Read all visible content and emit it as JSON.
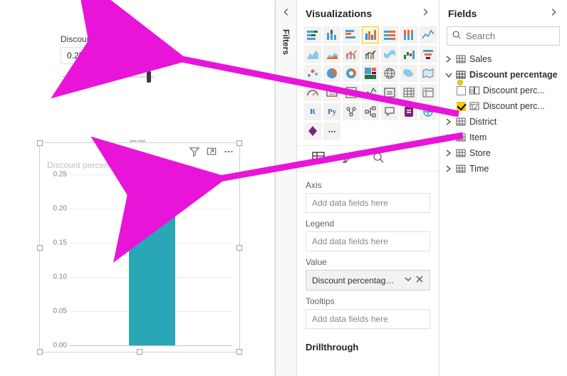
{
  "canvas": {
    "param_label": "Discount percentage",
    "param_value": "0.25",
    "visual_title": "Discount percentage Value"
  },
  "chart_data": {
    "type": "bar",
    "categories": [
      ""
    ],
    "values": [
      0.25
    ],
    "title": "Discount percentage Value",
    "xlabel": "",
    "ylabel": "",
    "ylim": [
      0.0,
      0.25
    ],
    "yticks": [
      0.0,
      0.05,
      0.1,
      0.15,
      0.2,
      0.25
    ]
  },
  "filters": {
    "label": "Filters"
  },
  "vis": {
    "title": "Visualizations",
    "wells": {
      "axis_label": "Axis",
      "axis_placeholder": "Add data fields here",
      "legend_label": "Legend",
      "legend_placeholder": "Add data fields here",
      "value_label": "Value",
      "value_chip": "Discount percentage Va",
      "tooltips_label": "Tooltips",
      "tooltips_placeholder": "Add data fields here"
    },
    "drill": "Drillthrough"
  },
  "fields": {
    "title": "Fields",
    "search_placeholder": "Search",
    "tables": {
      "sales": "Sales",
      "discount": "Discount percentage",
      "discount_child1": "Discount perc...",
      "discount_child2": "Discount perc...",
      "district": "District",
      "item": "Item",
      "store": "Store",
      "time": "Time"
    }
  }
}
